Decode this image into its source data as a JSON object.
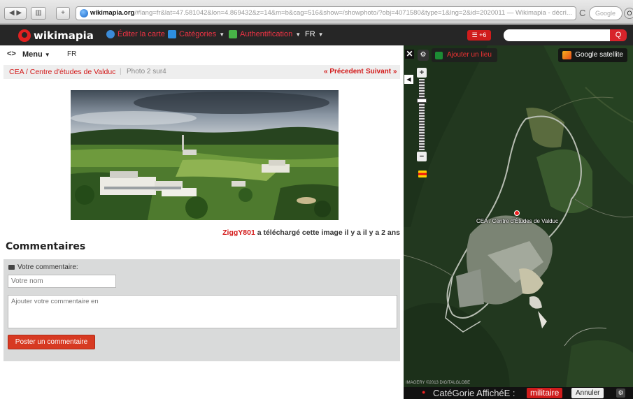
{
  "browser": {
    "url_host": "wikimapia.org",
    "url_rest": "/#lang=fr&lat=47.581042&lon=4.869432&z=14&m=b&cag=516&show=/showphoto/?obj=4071580&type=1&lng=2&id=2020011 — Wikimapia - décri...",
    "search_placeholder": "Google",
    "reload_glyph": "C",
    "tools_glyph": "O"
  },
  "header": {
    "logo": "wikimapia",
    "edit_map": "Éditer la carte",
    "categories": "Catégories",
    "auth": "Authentification",
    "lang": "FR",
    "notif": "☰ +6",
    "search_glyph": "Q"
  },
  "panel": {
    "menu_label": "Menu",
    "lang_label": "FR",
    "breadcrumb_link": "CEA / Centre d'études de Valduc",
    "breadcrumb_sep": "|",
    "photo_counter": "Photo 2 sur4",
    "prev_label": "« Précedent",
    "next_label": "Suivant »",
    "credit_user": "ZiggY801",
    "credit_text": " a téléchargé cette image il y a il y a 2 ans",
    "comments_title": "Commentaires",
    "comment_label": "Votre commentaire:",
    "name_placeholder": "Votre nom",
    "comment_placeholder": "Ajouter votre commentaire en",
    "post_button": "Poster un commentaire"
  },
  "map": {
    "add_place": "Ajouter un lieu",
    "layer_label": "Google satellite",
    "place_label": "CEA / Centre d'Études de Valduc",
    "attribution": "IMAGERY ©2013 DIGITALGLOBE",
    "category_label": "CatéGorie AffichéE :",
    "category_value": "militaire",
    "cancel_label": "Annuler"
  },
  "colors": {
    "accent_red": "#d31919",
    "header_bg": "#262626",
    "comment_box_bg": "#d9dada"
  }
}
